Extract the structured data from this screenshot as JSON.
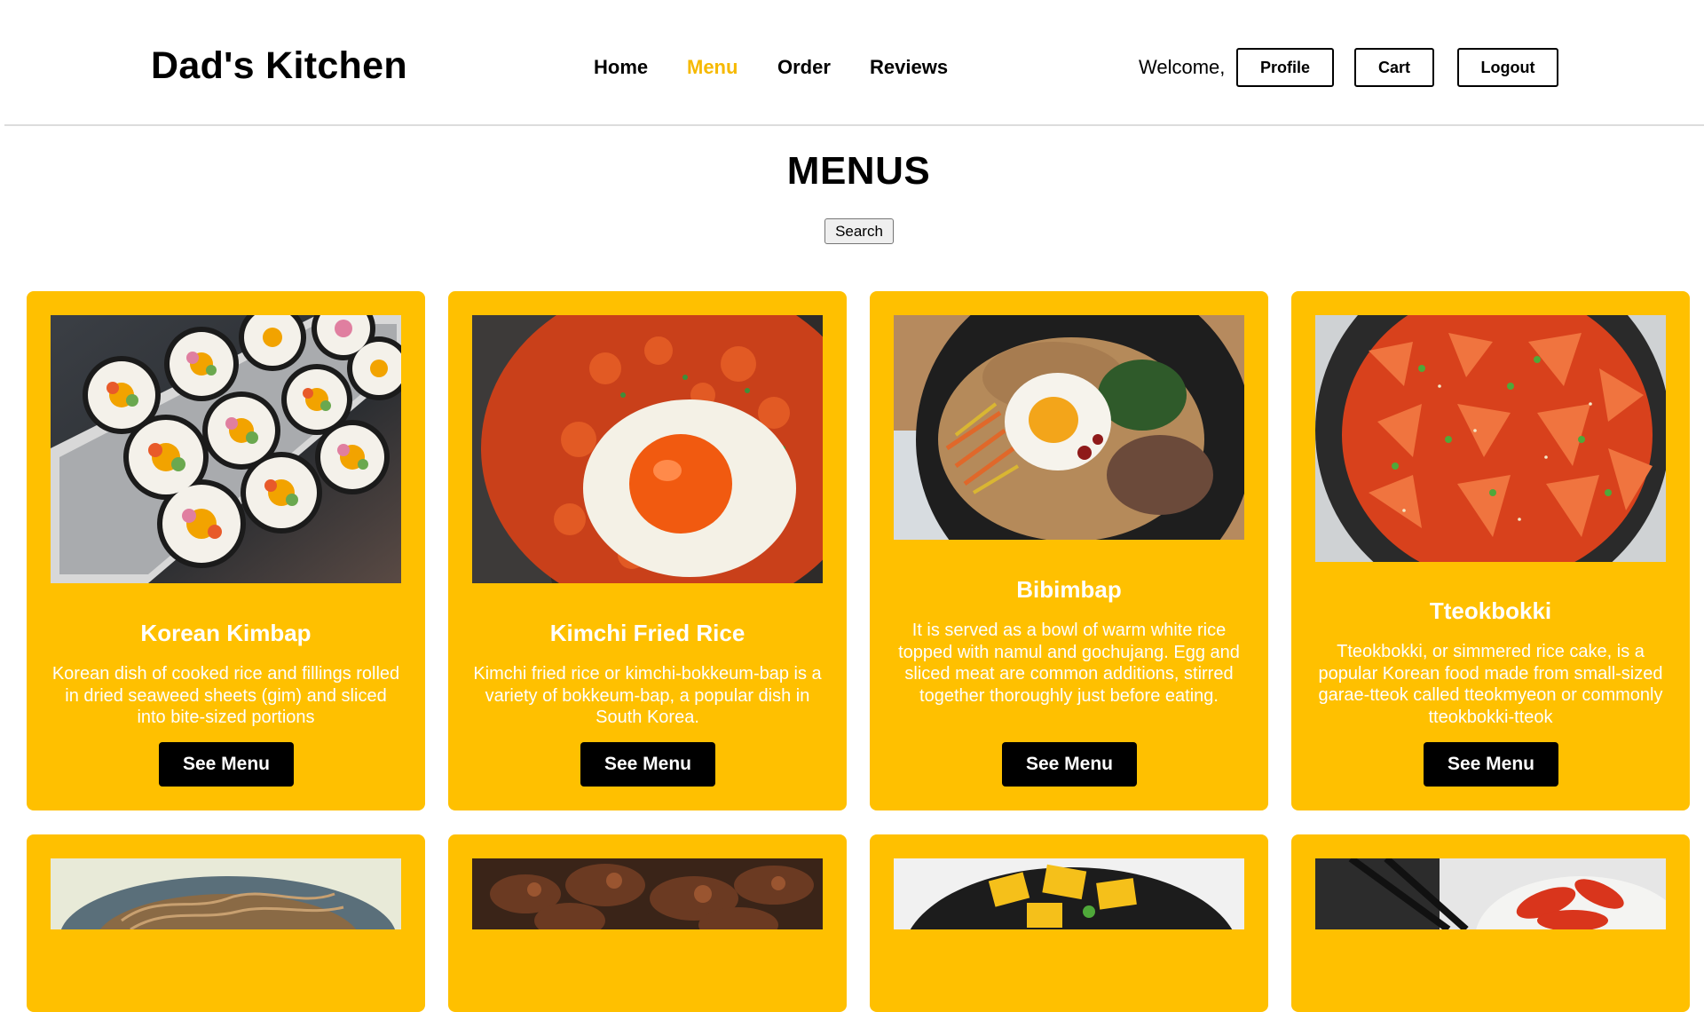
{
  "header": {
    "brand": "Dad's Kitchen",
    "nav": [
      {
        "label": "Home",
        "active": false
      },
      {
        "label": "Menu",
        "active": true
      },
      {
        "label": "Order",
        "active": false
      },
      {
        "label": "Reviews",
        "active": false
      }
    ],
    "welcome": "Welcome,",
    "profile_label": "Profile",
    "cart_label": "Cart",
    "logout_label": "Logout"
  },
  "main": {
    "title": "MENUS",
    "search_label": "Search",
    "cards": [
      {
        "title": "Korean Kimbap",
        "description": "Korean dish of cooked rice and fillings rolled in dried seaweed sheets (gim) and sliced into bite-sized portions",
        "button": "See Menu",
        "image": "kimbap-photo"
      },
      {
        "title": "Kimchi Fried Rice",
        "description": "Kimchi fried rice or kimchi-bokkeum-bap is a variety of bokkeum-bap, a popular dish in South Korea.",
        "button": "See Menu",
        "image": "kimchi-fried-rice-photo"
      },
      {
        "title": "Bibimbap",
        "description": "It is served as a bowl of warm white rice topped with namul and gochujang. Egg and sliced meat are common additions, stirred together thoroughly just before eating.",
        "button": "See Menu",
        "image": "bibimbap-photo"
      },
      {
        "title": "Tteokbokki",
        "description": "Tteokbokki, or simmered rice cake, is a popular Korean food made from small-sized garae-tteok called tteokmyeon or commonly tteokbokki-tteok",
        "button": "See Menu",
        "image": "tteokbokki-photo"
      }
    ],
    "second_row_images": [
      "japchae-photo",
      "bulgogi-photo",
      "mango-dish-photo",
      "kimchi-photo"
    ]
  },
  "colors": {
    "accent": "#ffc000",
    "active_nav": "#f6b900",
    "button_bg": "#000000"
  }
}
